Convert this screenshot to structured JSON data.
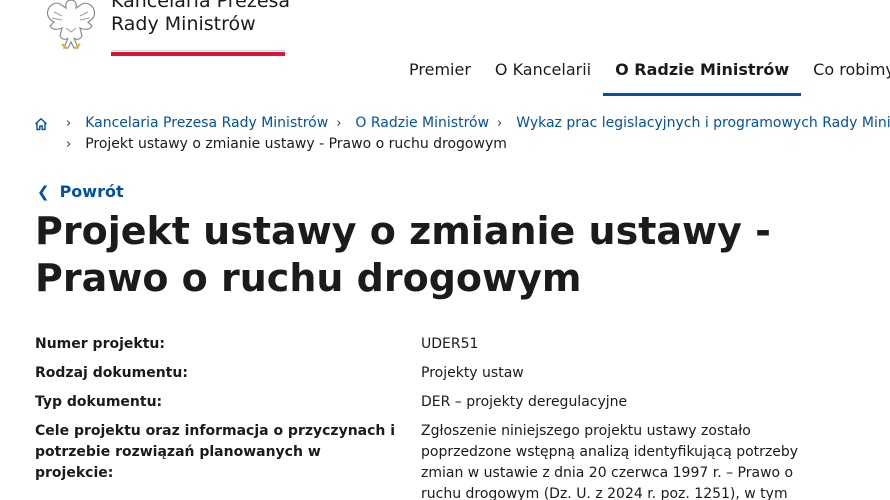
{
  "header": {
    "logo": {
      "line1": "Kancelaria Prezesa",
      "line2": "Rady Ministrów",
      "emblem_icon": "eagle-emblem-icon"
    },
    "nav": [
      {
        "label": "Premier",
        "active": false
      },
      {
        "label": "O Kancelarii",
        "active": false
      },
      {
        "label": "O Radzie Ministrów",
        "active": true
      },
      {
        "label": "Co robimy",
        "active": false
      }
    ]
  },
  "breadcrumb": {
    "home_icon": "home-icon",
    "items": [
      "Kancelaria Prezesa Rady Ministrów",
      "O Radzie Ministrów",
      "Wykaz prac legislacyjnych i programowych Rady Ministrów",
      "Projekt ustawy o zmianie ustawy - Prawo o ruchu drogowym"
    ]
  },
  "back": {
    "label": "Powrót",
    "icon": "chevron-left-icon"
  },
  "title": "Projekt ustawy o zmianie ustawy - Prawo o ruchu drogowym",
  "details": [
    {
      "label": "Numer projektu:",
      "value": "UDER51"
    },
    {
      "label": "Rodzaj dokumentu:",
      "value": "Projekty ustaw"
    },
    {
      "label": "Typ dokumentu:",
      "value": "DER – projekty deregulacyjne"
    },
    {
      "label": "Cele projektu oraz informacja o przyczynach i potrzebie rozwiązań planowanych w projekcie:",
      "value": "Zgłoszenie niniejszego projektu ustawy zostało poprzedzone wstępną analizą identyfikującą potrzeby zmian w ustawie z dnia 20 czerwca 1997 r. – Prawo o ruchu drogowym (Dz. U. z 2024 r. poz. 1251), w tym"
    }
  ],
  "colors": {
    "link": "#0052a5",
    "accent_red": "#dc143c",
    "text": "#1b1b1b"
  }
}
